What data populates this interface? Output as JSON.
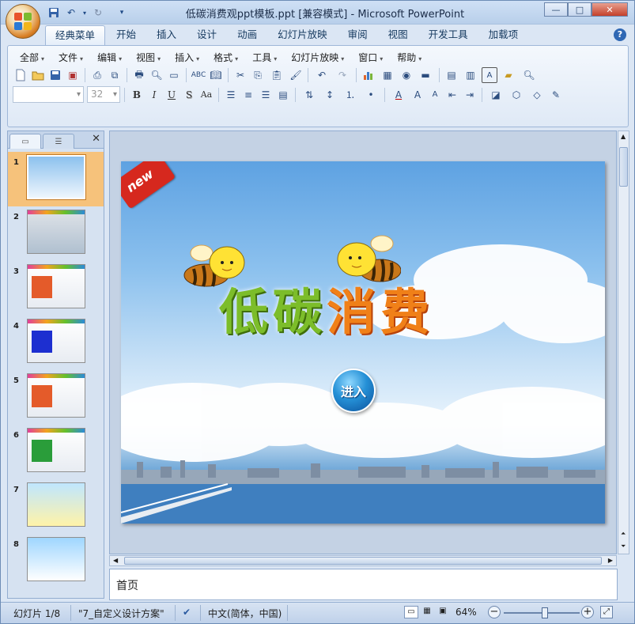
{
  "window": {
    "title": "低碳消费观ppt模板.ppt [兼容模式] - Microsoft PowerPoint",
    "controls": {
      "minimize": "—",
      "maximize": "□",
      "close": "✕"
    }
  },
  "ribbon": {
    "tabs": [
      "经典菜单",
      "开始",
      "插入",
      "设计",
      "动画",
      "幻灯片放映",
      "审阅",
      "视图",
      "开发工具",
      "加载项"
    ],
    "active_tab": "经典菜单",
    "menus": [
      "全部",
      "文件",
      "编辑",
      "视图",
      "插入",
      "格式",
      "工具",
      "幻灯片放映",
      "窗口",
      "帮助"
    ],
    "font_name": "",
    "font_size": "32",
    "format_buttons": [
      "B",
      "I",
      "U",
      "S",
      "Aa"
    ]
  },
  "slides_panel": {
    "thumbnails": [
      {
        "num": "1"
      },
      {
        "num": "2"
      },
      {
        "num": "3"
      },
      {
        "num": "4"
      },
      {
        "num": "5"
      },
      {
        "num": "6"
      },
      {
        "num": "7"
      },
      {
        "num": "8"
      }
    ],
    "selected": 1
  },
  "slide": {
    "badge": "new",
    "title_part1": "低碳",
    "title_part2": "消费",
    "enter_button": "进入"
  },
  "notes": {
    "text": "首页"
  },
  "status": {
    "slide_info": "幻灯片 1/8",
    "theme": "\"7_自定义设计方案\"",
    "language": "中文(简体，中国)",
    "zoom": "64%",
    "zoom_fraction": 0.55
  },
  "colors": {
    "accent": "#2f68b4",
    "title_green": "#5ea51d",
    "title_orange": "#ee6b10",
    "badge_red": "#d6281e"
  }
}
